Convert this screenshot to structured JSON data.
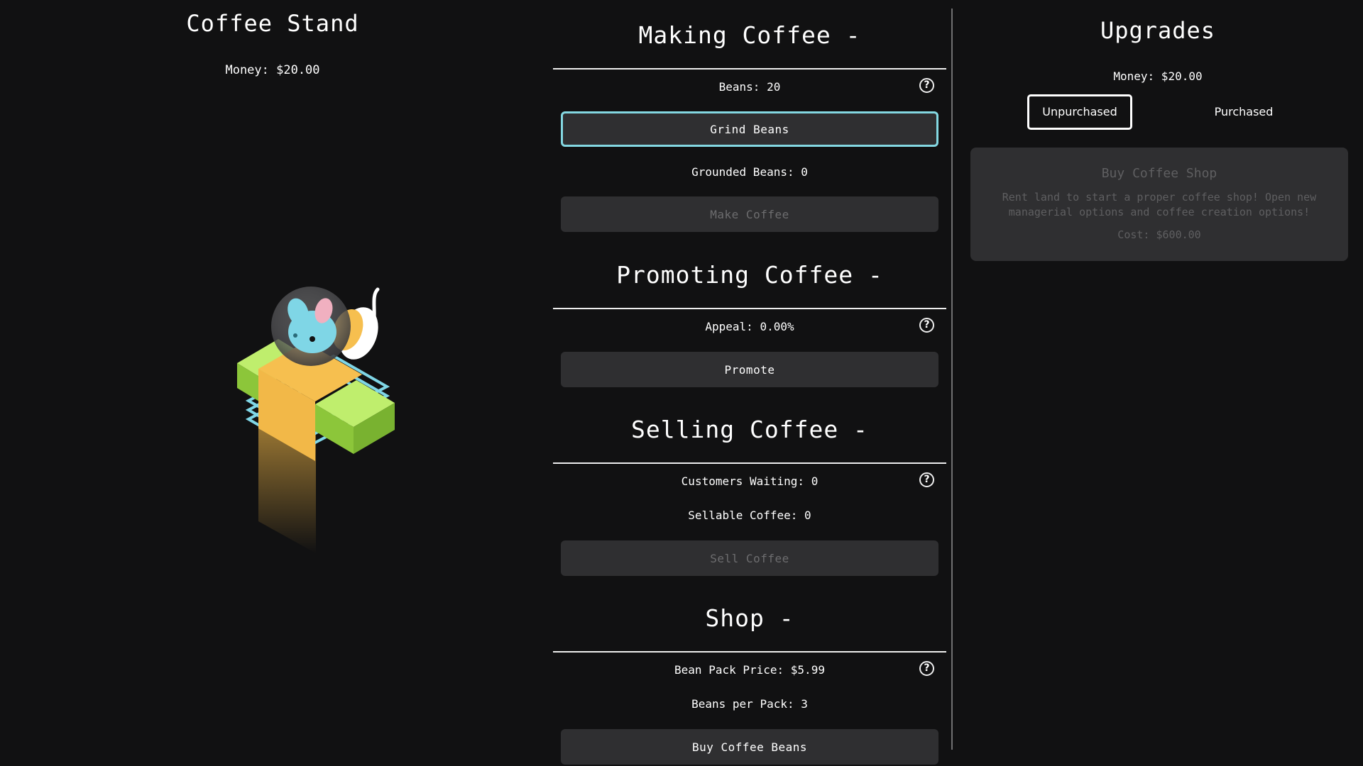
{
  "stand": {
    "title": "Coffee Stand",
    "money": "Money: $20.00"
  },
  "making": {
    "header": "Making Coffee -",
    "beans": "Beans: 20",
    "grind_label": "Grind Beans",
    "grounded": "Grounded Beans: 0",
    "make_label": "Make Coffee"
  },
  "promoting": {
    "header": "Promoting Coffee -",
    "appeal": "Appeal: 0.00%",
    "promote_label": "Promote"
  },
  "selling": {
    "header": "Selling Coffee -",
    "customers": "Customers Waiting: 0",
    "sellable": "Sellable Coffee: 0",
    "sell_label": "Sell Coffee"
  },
  "shop": {
    "header": "Shop -",
    "price": "Bean Pack Price: $5.99",
    "per_pack": "Beans per Pack: 3",
    "buy_label": "Buy Coffee Beans"
  },
  "help_glyph": "?",
  "upgrades": {
    "title": "Upgrades",
    "money": "Money: $20.00",
    "tabs": [
      "Unpurchased",
      "Purchased"
    ],
    "card": {
      "title": "Buy Coffee Shop",
      "desc": "Rent land to start a proper coffee shop! Open new managerial options and coffee creation options!",
      "cost": "Cost: $600.00"
    }
  },
  "colors": {
    "background": "#111112",
    "button": "#2f2f31",
    "focus_ring": "#84d8e2",
    "mascot_green": "#9fdc3f",
    "mascot_orange": "#f2b848",
    "mascot_cyan": "#7fd6e6"
  },
  "icons": {
    "help": "question-circle-icon",
    "mascot": "coffee-stand-mouse-illustration"
  }
}
